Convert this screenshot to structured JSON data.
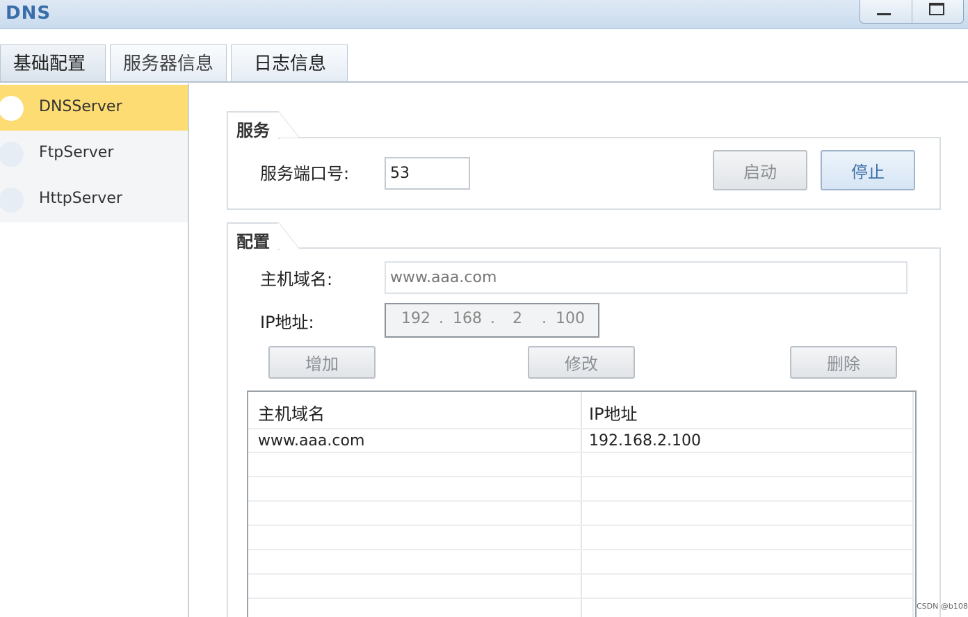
{
  "window": {
    "title": "DNS"
  },
  "tabs": [
    {
      "label": "基础配置"
    },
    {
      "label": "服务器信息"
    },
    {
      "label": "日志信息"
    }
  ],
  "sidebar": {
    "items": [
      {
        "label": "DNSServer",
        "active": true
      },
      {
        "label": "FtpServer",
        "active": false
      },
      {
        "label": "HttpServer",
        "active": false
      }
    ]
  },
  "service": {
    "group_title": "服务",
    "port_label": "服务端口号:",
    "port_value": "53",
    "start_label": "启动",
    "stop_label": "停止"
  },
  "config": {
    "group_title": "配置",
    "host_label": "主机域名:",
    "host_value": "www.aaa.com",
    "ip_label": "IP地址:",
    "ip_octets": [
      "192",
      "168",
      "2",
      "100"
    ],
    "add_label": "增加",
    "edit_label": "修改",
    "delete_label": "删除"
  },
  "table": {
    "headers": [
      "主机域名",
      "IP地址"
    ],
    "rows": [
      [
        "www.aaa.com",
        "192.168.2.100"
      ]
    ]
  },
  "watermark": "CSDN @b108"
}
